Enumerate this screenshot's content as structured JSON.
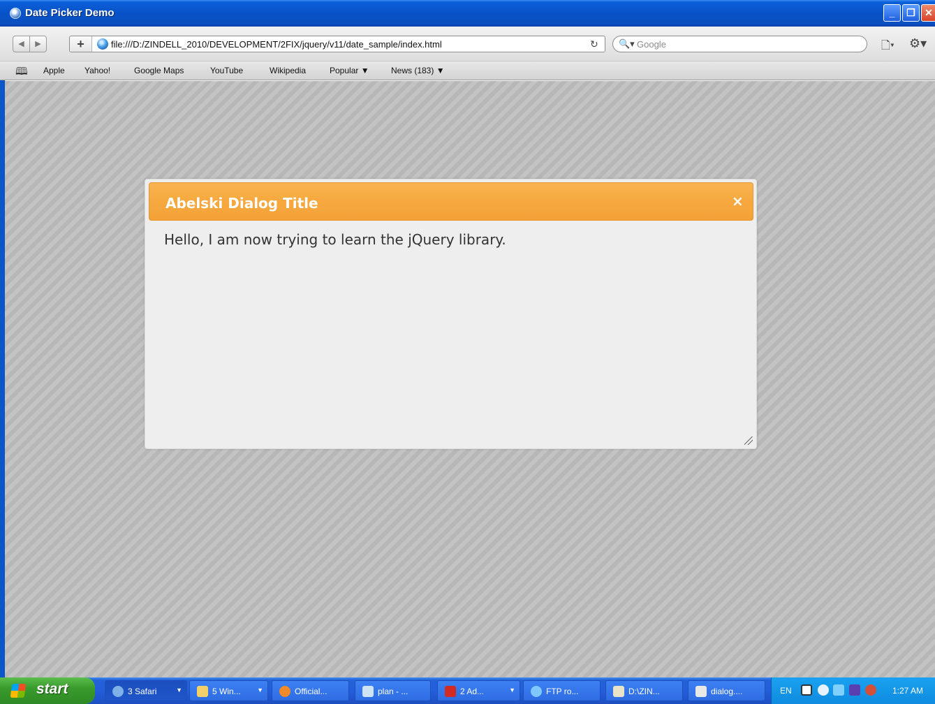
{
  "window": {
    "title": "Date Picker Demo"
  },
  "toolbar": {
    "url": "file:///D:/ZINDELL_2010/DEVELOPMENT/2FIX/jquery/v11/date_sample/index.html",
    "search_placeholder": "Google"
  },
  "bookmarks": {
    "items": [
      {
        "label": "Apple"
      },
      {
        "label": "Yahoo!"
      },
      {
        "label": "Google Maps"
      },
      {
        "label": "YouTube"
      },
      {
        "label": "Wikipedia"
      },
      {
        "label": "Popular ▼"
      },
      {
        "label": "News (183) ▼"
      }
    ]
  },
  "dialog": {
    "title": "Abelski Dialog Title",
    "close_label": "×",
    "body": "Hello, I am now trying to learn the jQuery library."
  },
  "taskbar": {
    "start_label": "start",
    "tasks": [
      {
        "label": "3 Safari",
        "icon": "safari-icon",
        "color": "#7fb0e8"
      },
      {
        "label": "5 Win...",
        "icon": "folder-icon",
        "color": "#f4d06a"
      },
      {
        "label": "Official...",
        "icon": "firefox-icon",
        "color": "#f08a2a"
      },
      {
        "label": "plan - ...",
        "icon": "document-icon",
        "color": "#cfe3f7"
      },
      {
        "label": "2 Ad...",
        "icon": "acrobat-icon",
        "color": "#d22b22"
      },
      {
        "label": "FTP ro...",
        "icon": "ie-icon",
        "color": "#7fc7ff"
      },
      {
        "label": "D:\\ZIN...",
        "icon": "editor-icon",
        "color": "#e9e4c8"
      },
      {
        "label": "dialog....",
        "icon": "file-icon",
        "color": "#e8e8e8"
      }
    ],
    "tray": {
      "lang": "EN",
      "clock": "1:27 AM"
    }
  }
}
